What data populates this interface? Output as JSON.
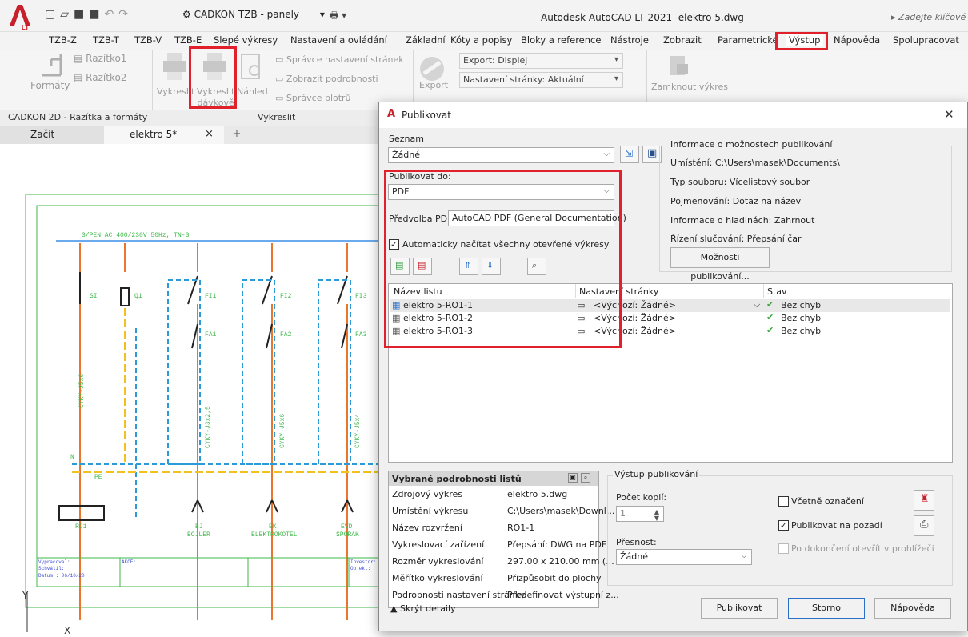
{
  "titlebar": {
    "quick_access": "CADKON TZB - panely",
    "app_title": "Autodesk AutoCAD LT 2021",
    "file": "elektro 5.dwg",
    "search_placeholder": "Zadejte klíčové slo",
    "logo_badge": "LT"
  },
  "ribbon_tabs": [
    "TZB-Z",
    "TZB-T",
    "TZB-V",
    "TZB-E",
    "Slepé výkresy",
    "Nastavení a ovládání",
    "Základní",
    "Kóty a popisy",
    "Bloky a reference",
    "Nástroje",
    "Zobrazit",
    "Parametrické",
    "Výstup",
    "Nápověda",
    "Spolupracovat"
  ],
  "ribbon": {
    "formaty": "Formáty",
    "razitko1": "Razítko1",
    "razitko2": "Razítko2",
    "panel1": "CADKON 2D - Razítka a formáty",
    "vykreslit": "Vykreslit",
    "vykreslit_davkove_1": "Vykreslit",
    "vykreslit_davkove_2": "dávkově",
    "nahled": "Náhled",
    "spravce_stranek": "Správce nastavení stránek",
    "zobrazit_podrobnosti": "Zobrazit podrobnosti",
    "spravce_plotru": "Správce plotrů",
    "panel2": "Vykreslit",
    "export": "Export",
    "export_combo": "Export: Displej",
    "nastaveni_combo": "Nastavení stránky: Aktuální",
    "zamknout": "Zamknout výkres"
  },
  "doc_tabs": {
    "start": "Začít",
    "doc": "elektro 5*",
    "close": "×",
    "add": "+"
  },
  "drawing": {
    "supply": "3/PEN AC 400/230V 50Hz, TN-S",
    "labels": [
      "SI",
      "Q1",
      "FI1",
      "FI2",
      "FI3",
      "FA1",
      "FA2",
      "FA3"
    ],
    "cables": [
      "CYKY-J5x6",
      "CYKY-J3x2,5",
      "CYKY-J5x6",
      "CYKY-J5x4"
    ],
    "n": "N",
    "pe": "PE",
    "loads": [
      "RO1",
      "BJ",
      "BOJLER",
      "EK",
      "ELEKTROKOTEL",
      "EVD",
      "SPORÁK"
    ],
    "stamp": [
      "Vypracoval:",
      "Schválil:",
      "Datum : 06/10/20",
      "AKCE:",
      "Investor:",
      "Objekt:"
    ],
    "y_axis": "Y",
    "x_axis": "X"
  },
  "dialog": {
    "title": "Publikovat",
    "close": "✕",
    "seznam_label": "Seznam",
    "seznam_value": "Žádné",
    "publikovat_do_label": "Publikovat do:",
    "publikovat_do_value": "PDF",
    "predvolba_label": "Předvolba PDF:",
    "predvolba_value": "AutoCAD PDF (General Documentation)",
    "auto_load": "Automaticky načítat všechny otevřené výkresy",
    "info": {
      "title": "Informace o možnostech publikování",
      "umisteni": "Umístění: C:\\Users\\masek\\Documents\\",
      "typ": "Typ souboru: Vícelistový soubor",
      "pojmenovani": "Pojmenování: Dotaz na název",
      "hladiny": "Informace o hladinách: Zahrnout",
      "slucovani": "Řízení slučování: Přepsání čar",
      "moznosti_btn": "Možnosti publikování..."
    },
    "table": {
      "headers": [
        "Název listu",
        "Nastavení stránky",
        "Stav"
      ],
      "rows": [
        {
          "name": "elektro 5-RO1-1",
          "setup": "<Výchozí: Žádné>",
          "status": "Bez chyb"
        },
        {
          "name": "elektro 5-RO1-2",
          "setup": "<Výchozí: Žádné>",
          "status": "Bez chyb"
        },
        {
          "name": "elektro 5-RO1-3",
          "setup": "<Výchozí: Žádné>",
          "status": "Bez chyb"
        }
      ]
    },
    "details": {
      "title": "Vybrané podrobnosti listů",
      "rows": [
        [
          "Zdrojový výkres",
          "elektro 5.dwg"
        ],
        [
          "Umístění výkresu",
          "C:\\Users\\masek\\Downl..."
        ],
        [
          "Název rozvržení",
          "RO1-1"
        ],
        [
          "Vykreslovací zařízení",
          "Přepsání: DWG na PDF"
        ],
        [
          "Rozměr vykreslování",
          "297.00 x 210.00 mm (..."
        ],
        [
          "Měřítko vykreslování",
          "Přizpůsobit do plochy"
        ],
        [
          "Podrobnosti nastavení stránky",
          "Předefinovat výstupní z..."
        ]
      ]
    },
    "output": {
      "title": "Výstup publikování",
      "copies_label": "Počet kopií:",
      "copies_value": "1",
      "precision_label": "Přesnost:",
      "precision_value": "Žádné",
      "include_stamp": "Včetně označení",
      "background": "Publikovat na pozadí",
      "open_viewer": "Po dokončení otevřít v prohlížeči"
    },
    "hide_details": "Skrýt detaily",
    "publish_btn": "Publikovat",
    "cancel_btn": "Storno",
    "help_btn": "Nápověda"
  }
}
